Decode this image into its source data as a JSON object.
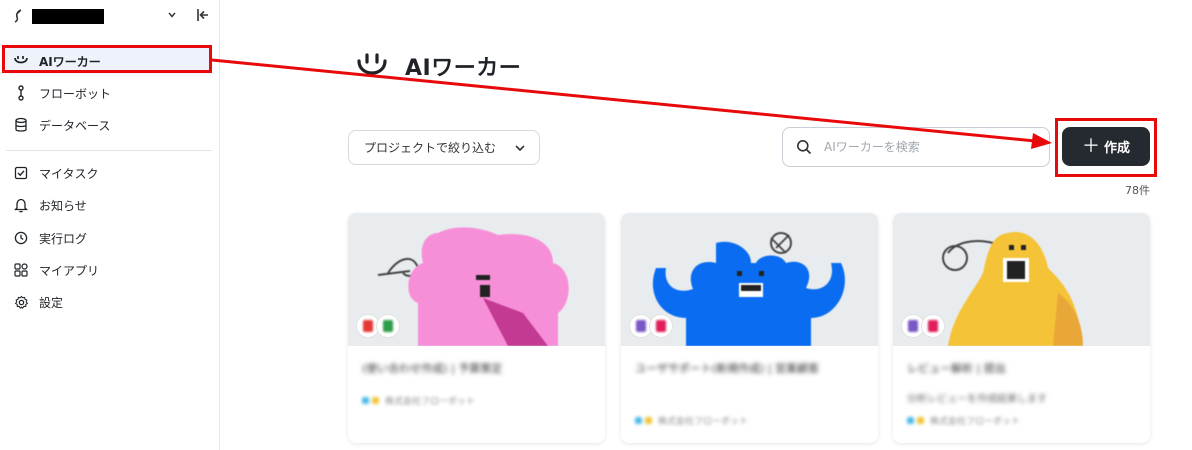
{
  "sidebar": {
    "collapse_icon": "collapse-left-icon",
    "items": [
      {
        "label": "AIワーカー",
        "icon": "ai-worker-icon",
        "active": true
      },
      {
        "label": "フローボット",
        "icon": "flowbot-icon"
      },
      {
        "label": "データベース",
        "icon": "database-icon"
      },
      {
        "label": "マイタスク",
        "icon": "checkbox-icon"
      },
      {
        "label": "お知らせ",
        "icon": "bell-icon"
      },
      {
        "label": "実行ログ",
        "icon": "clock-icon"
      },
      {
        "label": "マイアプリ",
        "icon": "apps-icon"
      },
      {
        "label": "設定",
        "icon": "gear-icon"
      }
    ]
  },
  "main": {
    "title": "AIワーカー",
    "project_filter_label": "プロジェクトで絞り込む",
    "search_placeholder": "AIワーカーを検索",
    "create_label": "作成",
    "count_label": "78件"
  },
  "cards": [
    {
      "title": "(使い合わせ作成) | 予算策定",
      "desc": "",
      "tag": "株式会社フローボット",
      "mascot_color": "#f78fd8"
    },
    {
      "title": "ユーザサポート(新規作成) | 営業顧客",
      "desc": "",
      "tag": "株式会社フローボット",
      "mascot_color": "#0a6cf0"
    },
    {
      "title": "レビュー解析 | 提出",
      "desc": "分析レビューを作成結果します",
      "tag": "株式会社フローボット",
      "mascot_color": "#f5c337"
    }
  ],
  "colors": {
    "accent_dark": "#252a30",
    "annotation_red": "#e8090b",
    "active_bg": "#eef3fb"
  }
}
